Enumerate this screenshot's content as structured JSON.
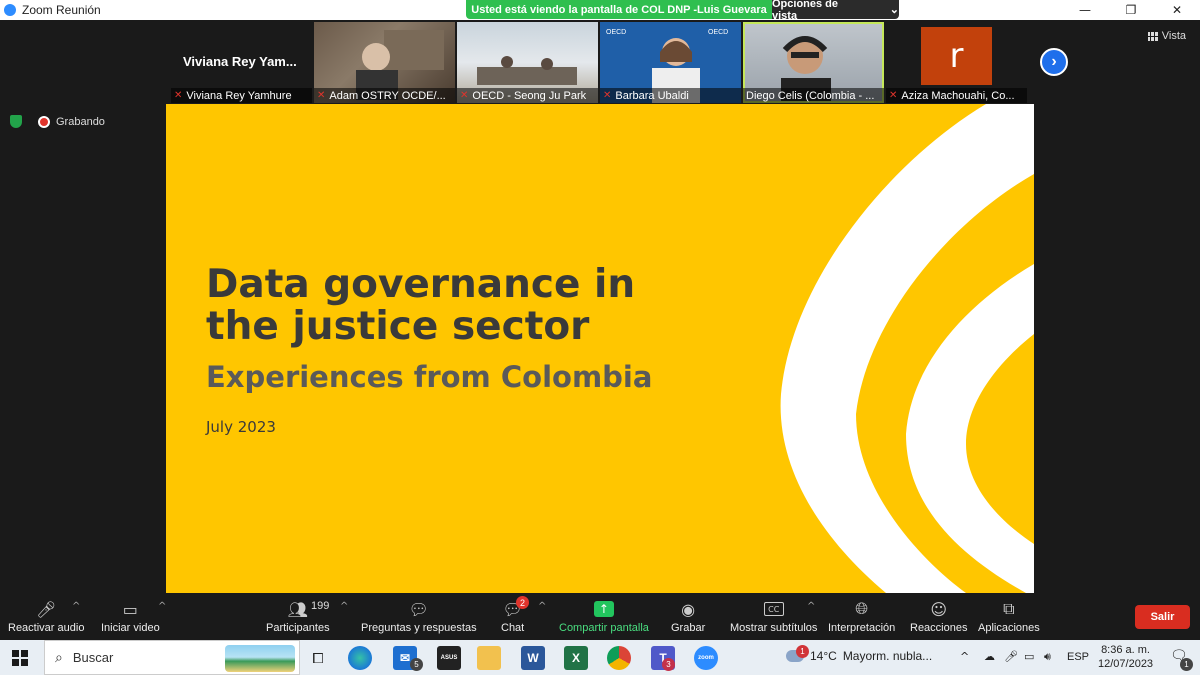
{
  "window": {
    "title": "Zoom Reunión",
    "minimize": "—",
    "maximize": "❐",
    "close": "✕"
  },
  "share_banner": {
    "text": "Usted está viendo la pantalla de COL DNP -Luis Guevara",
    "view_options": "Opciones de vista",
    "chevron": "⌄"
  },
  "view": {
    "label": "Vista"
  },
  "participants_strip": [
    {
      "name": "Viviana Rey Yamhure",
      "big_name": "Viviana Rey Yam...",
      "type": "text"
    },
    {
      "name": "Adam OSTRY OCDE/...",
      "type": "video"
    },
    {
      "name": "OECD - Seong Ju Park",
      "type": "video"
    },
    {
      "name": "Barbara Ubaldi",
      "type": "video"
    },
    {
      "name": "Diego Celis (Colombia - ...",
      "type": "video",
      "active": true
    },
    {
      "name": "Aziza Machouahi, Co...",
      "type": "avatar",
      "initial": "r"
    }
  ],
  "next_arrow": "›",
  "recording": {
    "label": "Grabando"
  },
  "slide": {
    "title_line1": "Data governance in",
    "title_line2": "the justice sector",
    "subtitle": "Experiences from Colombia",
    "date": "July 2023"
  },
  "toolbar": {
    "unmute": "Reactivar audio",
    "start_video": "Iniciar video",
    "participants": "Participantes",
    "participants_count": "199",
    "qa": "Preguntas y respuestas",
    "chat": "Chat",
    "chat_badge": "2",
    "share": "Compartir pantalla",
    "record": "Grabar",
    "captions": "Mostrar subtítulos",
    "captions_icon": "CC",
    "interpretation": "Interpretación",
    "reactions": "Reacciones",
    "apps": "Aplicaciones",
    "leave": "Salir"
  },
  "taskbar": {
    "search": "Buscar",
    "mail_badge": "5",
    "teams_badge": "3",
    "weather_temp": "14°C",
    "weather_text": "Mayorm. nubla...",
    "weather_alert": "1",
    "lang": "ESP",
    "time": "8:36 a. m.",
    "date": "12/07/2023",
    "notif_count": "1",
    "apps": [
      "task-view",
      "edge",
      "mail",
      "asus",
      "file-explorer",
      "word",
      "excel",
      "chrome",
      "teams",
      "zoom"
    ]
  }
}
